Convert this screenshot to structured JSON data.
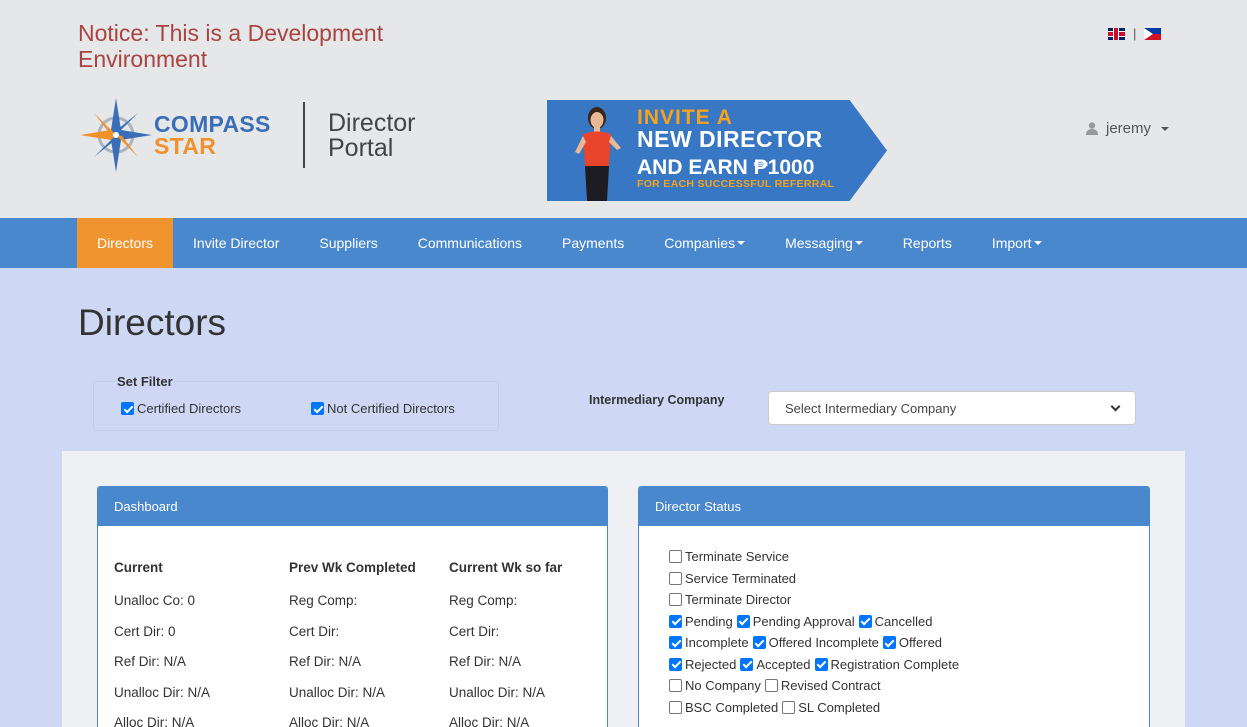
{
  "notice": "Notice: This is a Development Environment",
  "header": {
    "flag_separator": "|",
    "logo_line1": "COMPASS",
    "logo_line2": "STAR",
    "portal_label": "Director Portal",
    "user_name": "jeremy"
  },
  "banner": {
    "line1": "INVITE A",
    "line2": "NEW DIRECTOR",
    "line3": "AND EARN ₱1000",
    "line4": "FOR EACH SUCCESSFUL REFERRAL"
  },
  "nav": {
    "items": [
      {
        "label": "Directors",
        "active": true
      },
      {
        "label": "Invite Director"
      },
      {
        "label": "Suppliers"
      },
      {
        "label": "Communications"
      },
      {
        "label": "Payments"
      },
      {
        "label": "Companies",
        "dropdown": true
      },
      {
        "label": "Messaging",
        "dropdown": true
      },
      {
        "label": "Reports"
      },
      {
        "label": "Import",
        "dropdown": true
      }
    ]
  },
  "page": {
    "title": "Directors"
  },
  "filter": {
    "legend": "Set Filter",
    "certified": {
      "label": "Certified Directors",
      "checked": true
    },
    "not_certified": {
      "label": "Not Certified Directors",
      "checked": true
    }
  },
  "intermediary": {
    "label": "Intermediary Company",
    "selected": "Select Intermediary Company"
  },
  "dashboard": {
    "title": "Dashboard",
    "columns": [
      {
        "header": "Current",
        "rows": [
          "Unalloc Co: 0",
          "Cert Dir: 0",
          "Ref Dir: N/A",
          "Unalloc Dir: N/A",
          "Alloc Dir: N/A"
        ]
      },
      {
        "header": "Prev Wk Completed",
        "rows": [
          "Reg Comp:",
          "Cert Dir:",
          "Ref Dir: N/A",
          "Unalloc Dir: N/A",
          "Alloc Dir: N/A"
        ]
      },
      {
        "header": "Current Wk so far",
        "rows": [
          "Reg Comp:",
          "Cert Dir:",
          "Ref Dir: N/A",
          "Unalloc Dir: N/A",
          "Alloc Dir: N/A"
        ]
      }
    ]
  },
  "director_status": {
    "title": "Director Status",
    "rows": [
      [
        {
          "label": "Terminate Service",
          "checked": false
        }
      ],
      [
        {
          "label": "Service Terminated",
          "checked": false
        }
      ],
      [
        {
          "label": "Terminate Director",
          "checked": false
        }
      ],
      [
        {
          "label": "Pending",
          "checked": true
        },
        {
          "label": "Pending Approval",
          "checked": true
        },
        {
          "label": "Cancelled",
          "checked": true
        }
      ],
      [
        {
          "label": "Incomplete",
          "checked": true
        },
        {
          "label": "Offered Incomplete",
          "checked": true
        },
        {
          "label": "Offered",
          "checked": true
        }
      ],
      [
        {
          "label": "Rejected",
          "checked": true
        },
        {
          "label": "Accepted",
          "checked": true
        },
        {
          "label": "Registration Complete",
          "checked": true
        }
      ],
      [
        {
          "label": "No Company",
          "checked": false
        },
        {
          "label": "Revised Contract",
          "checked": false
        }
      ],
      [
        {
          "label": "BSC Completed",
          "checked": false
        },
        {
          "label": "SL Completed",
          "checked": false
        }
      ]
    ]
  }
}
